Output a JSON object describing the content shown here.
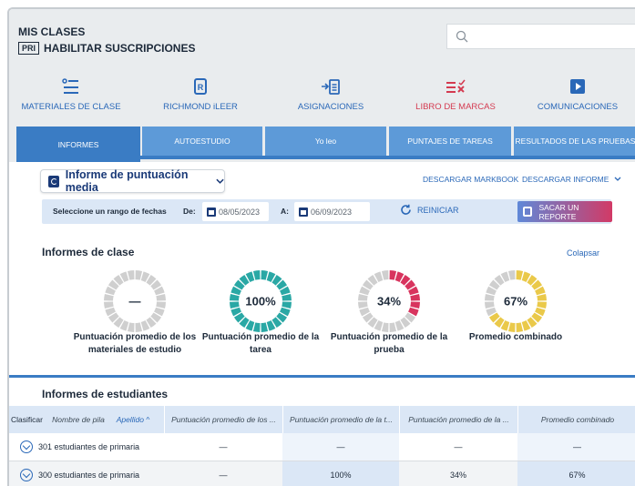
{
  "header": {
    "title": "MIS CLASES",
    "badge": "PRI",
    "subtitle": "HABILITAR SUSCRIPCIONES",
    "search_placeholder": ""
  },
  "nav": [
    {
      "label": "MATERIALES DE CLASE",
      "icon": "list-icon",
      "color": "#2a68b8"
    },
    {
      "label": "RICHMOND iLEER",
      "icon": "book-r-icon",
      "color": "#2a68b8"
    },
    {
      "label": "ASIGNACIONES",
      "icon": "assign-icon",
      "color": "#2a68b8"
    },
    {
      "label": "LIBRO DE MARCAS",
      "icon": "markbook-icon",
      "color": "#d43a50"
    },
    {
      "label": "COMUNICACIONES",
      "icon": "play-icon",
      "color": "#2a68b8"
    }
  ],
  "tabs": [
    "INFORMES",
    "AUTOESTUDIO",
    "Yo leo",
    "PUNTAJES DE TAREAS",
    "RESULTADOS DE LAS PRUEBAS"
  ],
  "report": {
    "selector": "Informe de puntuación media",
    "download_markbook": "DESCARGAR MARKBOOK",
    "download_report": "DESCARGAR INFORME",
    "range_label": "Seleccione un rango de fechas",
    "from_label": "De:",
    "from_date": "08/05/2023",
    "to_label": "A:",
    "to_date": "06/09/2023",
    "reset": "REINICIAR",
    "generate": "SACAR UN REPORTE"
  },
  "class_reports": {
    "title": "Informes de clase",
    "collapse": "Colapsar",
    "rings": [
      {
        "value_text": "—",
        "fraction": 0,
        "color": "#c9c9c9",
        "label": "Puntuación promedio de los materiales de estudio"
      },
      {
        "value_text": "100%",
        "fraction": 1.0,
        "color": "#2aa8a5",
        "label": "Puntuación promedio de la tarea"
      },
      {
        "value_text": "34%",
        "fraction": 0.34,
        "color": "#d8345e",
        "label": "Puntuación promedio de la prueba"
      },
      {
        "value_text": "67%",
        "fraction": 0.67,
        "color": "#eac94a",
        "label": "Promedio combinado"
      }
    ]
  },
  "student_reports": {
    "title": "Informes de estudiantes",
    "sort_label": "Clasificar",
    "first_name_col": "Nombre de pila",
    "last_name_col": "Apellido ^",
    "columns": [
      "Puntuación promedio de los ...",
      "Puntuación promedio de la t...",
      "Puntuación promedio de la ...",
      "Promedio combinado"
    ],
    "rows": [
      {
        "name": "301 estudiantes de primaria",
        "values": [
          "—",
          "—",
          "—",
          "—"
        ]
      },
      {
        "name": "300 estudiantes de primaria",
        "values": [
          "—",
          "100%",
          "34%",
          "67%"
        ]
      }
    ]
  }
}
